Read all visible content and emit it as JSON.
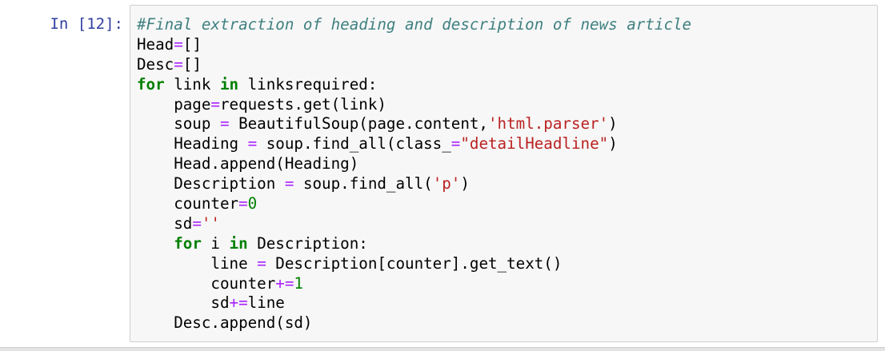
{
  "cell": {
    "prompt": "In [12]:",
    "lines": [
      [
        {
          "t": "#Final extraction of heading and description of news article",
          "c": "comment"
        }
      ],
      [
        {
          "t": "Head",
          "c": ""
        },
        {
          "t": "=",
          "c": "op"
        },
        {
          "t": "[]",
          "c": ""
        }
      ],
      [
        {
          "t": "Desc",
          "c": ""
        },
        {
          "t": "=",
          "c": "op"
        },
        {
          "t": "[]",
          "c": ""
        }
      ],
      [
        {
          "t": "for",
          "c": "keyword"
        },
        {
          "t": " link ",
          "c": ""
        },
        {
          "t": "in",
          "c": "keyword"
        },
        {
          "t": " linksrequired:",
          "c": ""
        }
      ],
      [
        {
          "t": "    page",
          "c": ""
        },
        {
          "t": "=",
          "c": "op"
        },
        {
          "t": "requests.get(link)",
          "c": ""
        }
      ],
      [
        {
          "t": "    soup ",
          "c": ""
        },
        {
          "t": "=",
          "c": "op"
        },
        {
          "t": " BeautifulSoup(page.content,",
          "c": ""
        },
        {
          "t": "'html.parser'",
          "c": "string"
        },
        {
          "t": ")",
          "c": ""
        }
      ],
      [
        {
          "t": "    Heading ",
          "c": ""
        },
        {
          "t": "=",
          "c": "op"
        },
        {
          "t": " soup.find_all(class_",
          "c": ""
        },
        {
          "t": "=",
          "c": "op"
        },
        {
          "t": "\"detailHeadline\"",
          "c": "string"
        },
        {
          "t": ")",
          "c": ""
        }
      ],
      [
        {
          "t": "    Head.append(Heading)",
          "c": ""
        }
      ],
      [
        {
          "t": "    Description ",
          "c": ""
        },
        {
          "t": "=",
          "c": "op"
        },
        {
          "t": " soup.find_all(",
          "c": ""
        },
        {
          "t": "'p'",
          "c": "string"
        },
        {
          "t": ")",
          "c": ""
        }
      ],
      [
        {
          "t": "    counter",
          "c": ""
        },
        {
          "t": "=",
          "c": "op"
        },
        {
          "t": "0",
          "c": "number"
        }
      ],
      [
        {
          "t": "    sd",
          "c": ""
        },
        {
          "t": "=",
          "c": "op"
        },
        {
          "t": "''",
          "c": "string"
        }
      ],
      [
        {
          "t": "    ",
          "c": ""
        },
        {
          "t": "for",
          "c": "keyword"
        },
        {
          "t": " i ",
          "c": ""
        },
        {
          "t": "in",
          "c": "keyword"
        },
        {
          "t": " Description:",
          "c": ""
        }
      ],
      [
        {
          "t": "        line ",
          "c": ""
        },
        {
          "t": "=",
          "c": "op"
        },
        {
          "t": " Description[counter].get_text()",
          "c": ""
        }
      ],
      [
        {
          "t": "        counter",
          "c": ""
        },
        {
          "t": "+=",
          "c": "op"
        },
        {
          "t": "1",
          "c": "number"
        }
      ],
      [
        {
          "t": "        sd",
          "c": ""
        },
        {
          "t": "+=",
          "c": "op"
        },
        {
          "t": "line",
          "c": ""
        }
      ],
      [
        {
          "t": "    Desc.append(sd)",
          "c": ""
        }
      ]
    ]
  },
  "colors": {
    "prompt": "#303f9f",
    "comment": "#408080",
    "keyword": "#008000",
    "operator": "#aa22ff",
    "string": "#ba2121",
    "number": "#008000",
    "cell_background": "#f7f7f7",
    "cell_border": "#cfcfcf"
  }
}
